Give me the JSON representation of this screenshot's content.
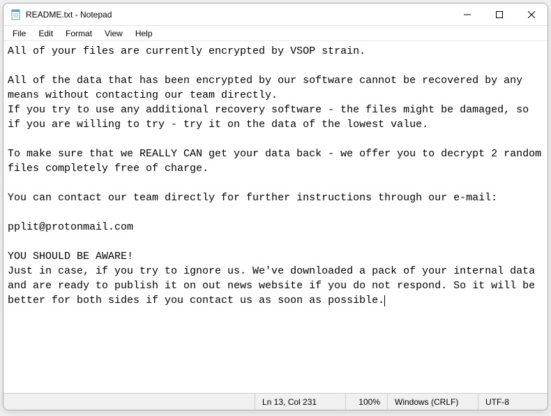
{
  "window": {
    "title": "README.txt - Notepad"
  },
  "menu": {
    "file": "File",
    "edit": "Edit",
    "format": "Format",
    "view": "View",
    "help": "Help"
  },
  "document": {
    "text": "All of your files are currently encrypted by VSOP strain.\n\nAll of the data that has been encrypted by our software cannot be recovered by any means without contacting our team directly.\nIf you try to use any additional recovery software - the files might be damaged, so if you are willing to try - try it on the data of the lowest value.\n\nTo make sure that we REALLY CAN get your data back - we offer you to decrypt 2 random files completely free of charge.\n\nYou can contact our team directly for further instructions through our e-mail:\n\npplit@protonmail.com\n\nYOU SHOULD BE AWARE!\nJust in case, if you try to ignore us. We've downloaded a pack of your internal data and are ready to publish it on out news website if you do not respond. So it will be better for both sides if you contact us as soon as possible."
  },
  "status": {
    "position": "Ln 13, Col 231",
    "zoom": "100%",
    "eol": "Windows (CRLF)",
    "encoding": "UTF-8"
  }
}
